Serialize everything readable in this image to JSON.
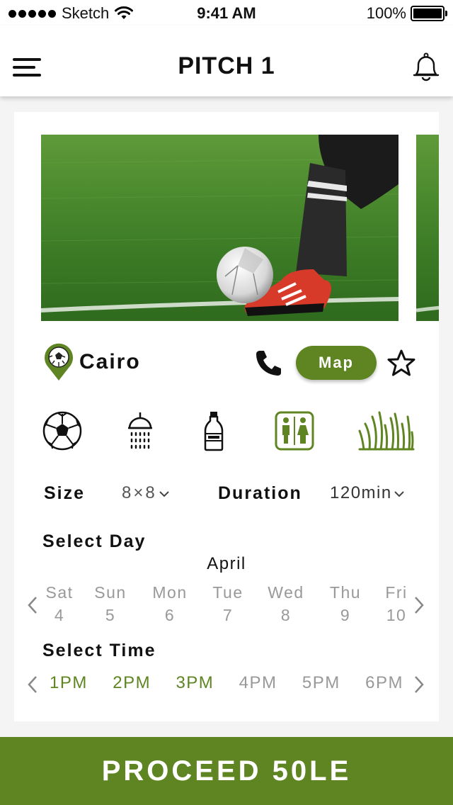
{
  "status_bar": {
    "carrier": "Sketch",
    "time": "9:41 AM",
    "battery": "100%"
  },
  "nav": {
    "title": "PITCH 1"
  },
  "venue": {
    "location": "Cairo",
    "map_label": "Map"
  },
  "amenities": [
    "football-icon",
    "shower-icon",
    "water-bottle-icon",
    "restroom-icon",
    "grass-icon"
  ],
  "filters": {
    "size_label": "Size",
    "size_value": "8×8",
    "duration_label": "Duration",
    "duration_value": "120min"
  },
  "select_day": {
    "title": "Select Day",
    "month": "April",
    "days": [
      {
        "name": "Sat",
        "date": "4"
      },
      {
        "name": "Sun",
        "date": "5"
      },
      {
        "name": "Mon",
        "date": "6"
      },
      {
        "name": "Tue",
        "date": "7"
      },
      {
        "name": "Wed",
        "date": "8"
      },
      {
        "name": "Thu",
        "date": "9"
      },
      {
        "name": "Fri",
        "date": "10"
      }
    ]
  },
  "select_time": {
    "title": "Select Time",
    "times": [
      "1PM",
      "2PM",
      "3PM",
      "4PM",
      "5PM",
      "6PM"
    ],
    "available_count": 3
  },
  "proceed": {
    "label": "PROCEED 50LE"
  },
  "colors": {
    "accent": "#5f8522",
    "muted": "#999999",
    "card": "#ffffff",
    "background": "#f4f4f4"
  }
}
